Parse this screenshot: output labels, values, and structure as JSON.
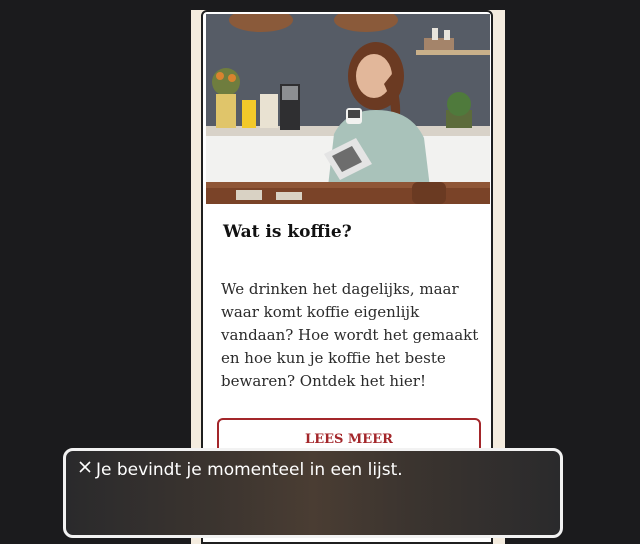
{
  "article": {
    "title": "Wat is koffie?",
    "body": "We drinken het dagelijks, maar waar komt koffie eigenlijk vandaan? Hoe wordt het gemaakt en hoe kun je koffie het beste bewaren? Ontdek het hier!",
    "button_label": "LEES MEER",
    "image": "woman-drinking-coffee-photo"
  },
  "voiceover": {
    "message": "Je bevindt je momenteel in een lijst.",
    "close_icon": "close-icon"
  },
  "colors": {
    "accent": "#a3262a",
    "page_background": "#f4ecdf",
    "screen_background": "#1b1b1d"
  }
}
